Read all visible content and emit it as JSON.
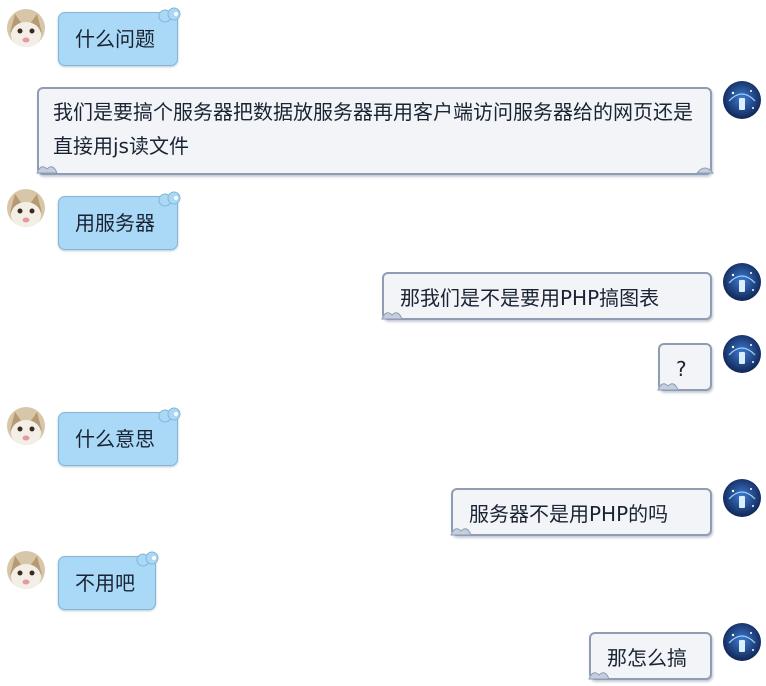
{
  "chat": {
    "messages": [
      {
        "id": "m1",
        "side": "left",
        "text": "什么问题"
      },
      {
        "id": "m2",
        "side": "right",
        "text": "我们是要搞个服务器把数据放服务器再用客户端访问服务器给的网页还是直接用js读文件"
      },
      {
        "id": "m3",
        "side": "left",
        "text": "用服务器"
      },
      {
        "id": "m4",
        "side": "right",
        "text": "那我们是不是要用PHP搞图表"
      },
      {
        "id": "m5",
        "side": "right",
        "text": "?"
      },
      {
        "id": "m6",
        "side": "left",
        "text": "什么意思"
      },
      {
        "id": "m7",
        "side": "right",
        "text": "服务器不是用PHP的吗"
      },
      {
        "id": "m8",
        "side": "left",
        "text": "不用吧"
      },
      {
        "id": "m9",
        "side": "right",
        "text": "那怎么搞"
      }
    ]
  },
  "colors": {
    "left_bubble": "#a9d9f7",
    "right_bubble": "#f3f4f8",
    "text": "#1a2333"
  },
  "icons": {
    "left_avatar": "cat-avatar-icon",
    "right_avatar": "blue-tech-avatar-icon"
  }
}
